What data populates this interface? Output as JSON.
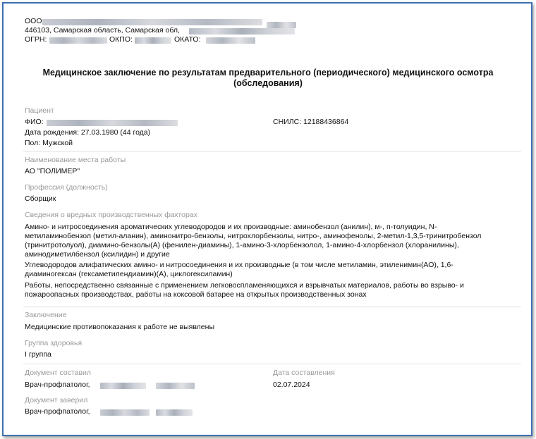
{
  "org": {
    "name_prefix": "ООО",
    "address": "446103, Самарская область, Самарская обл,",
    "ogrn_label": "ОГРН:",
    "okpo_label": "ОКПО:",
    "okato_label": "ОКАТО:"
  },
  "title": "Медицинское заключение по результатам предварительного (периодического) медицинского осмотра (обследования)",
  "patient": {
    "section_label": "Пациент",
    "fio_label": "ФИО:",
    "snils": "СНИЛС: 12188436864",
    "birth": "Дата рождения: 27.03.1980 (44 года)",
    "sex": "Пол: Мужской"
  },
  "workplace": {
    "label": "Наименование места работы",
    "value": "АО \"ПОЛИМЕР\""
  },
  "profession": {
    "label": "Профессия (должность)",
    "value": "Сборщик"
  },
  "hazards": {
    "label": "Сведения о вредных производственных факторах",
    "items": [
      {
        "line1": "Амино- и нитросоединения ароматических углеводородов и их производные: аминобензол (анилин), м-, п-толуидин, N-",
        "line2": "метиламинобензол (метил-аланин), аминонитро-бензолы, нитрохлорбензолы, нитро-, аминофенолы, 2-метил-1,3,5-тринитробензол",
        "line3": "(тринитротолуол), диамино-бензолы(А) (фенилен-диамины), 1-амино-3-хлорбензолол, 1-амино-4-хлорбензол (хлоранилины),",
        "line4": "аминодиметилбензол (ксилидин) и другие"
      },
      {
        "line1": "Углеводородов алифатических амино- и нитросоединения и их производные (в том числе метиламин, этиленимин(АО), 1,6-",
        "line2": "диаминогексан (гексаметилендиамин)(А), циклогексиламин)"
      },
      {
        "line1": "Работы, непосредственно связанные с применением легковоспламеняющихся и взрывчатых материалов, работы во взрыво- и",
        "line2": "пожароопасных производствах, работы на коксовой батарее на открытых производственных зонах"
      }
    ]
  },
  "conclusion": {
    "label": "Заключение",
    "value": "Медицинские противопоказания к работе не выявлены"
  },
  "health_group": {
    "label": "Группа здоровья",
    "value": "I группа"
  },
  "composed_by": {
    "label": "Документ составил",
    "value": "Врач-профпатолог,"
  },
  "composed_date": {
    "label": "Дата составления",
    "value": "02.07.2024"
  },
  "certified_by": {
    "label": "Документ заверил",
    "value": "Врач-профпатолог,"
  }
}
